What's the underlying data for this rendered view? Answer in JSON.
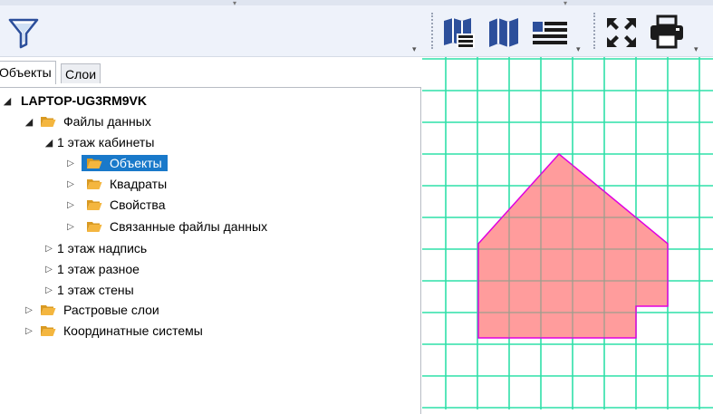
{
  "toolbar": {
    "icons": [
      "filter-icon",
      "map-book-icon",
      "map-icon",
      "legend-list-icon",
      "zoom-extent-icon",
      "printer-icon"
    ],
    "grip_glyph": "▾",
    "top_caret_glyph": "▾"
  },
  "tabs": [
    {
      "label": "Объекты",
      "active": true
    },
    {
      "label": "Слои",
      "active": false
    }
  ],
  "tree": {
    "root": "LAPTOP-UG3RM9VK",
    "data_files": "Файлы данных",
    "floor1_rooms": "1 этаж кабинеты",
    "objects": "Объекты",
    "squares": "Квадраты",
    "properties": "Свойства",
    "linked_files": "Связанные файлы данных",
    "floor1_label": "1 этаж надпись",
    "floor1_misc": "1 этаж разное",
    "floor1_walls": "1 этаж стены",
    "raster_layers": "Растровые слои",
    "coord_systems": "Координатные системы"
  },
  "colors": {
    "accent": "#1979ca",
    "grid": "#2fe0a8",
    "polygon_fill": "#ff9494",
    "polygon_stroke": "#e000e0",
    "folder": "#f4b63f",
    "icon_blue": "#2c4f9b"
  }
}
